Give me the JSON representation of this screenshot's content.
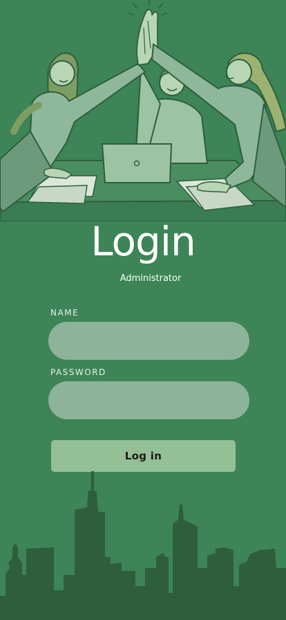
{
  "screen": {
    "title": "Login",
    "subtitle": "Administrator"
  },
  "form": {
    "name_label": "NAME",
    "name_value": "",
    "password_label": "PASSWORD",
    "password_value": "",
    "submit_label": "Log in"
  },
  "illustrations": {
    "hero": "team-high-five-illustration",
    "footer": "city-skyline-silhouette"
  },
  "colors": {
    "background": "#3d8456",
    "field": "#8db39a",
    "button": "#95bf95",
    "skyline": "#2f5e3d",
    "title": "#ffffff"
  }
}
